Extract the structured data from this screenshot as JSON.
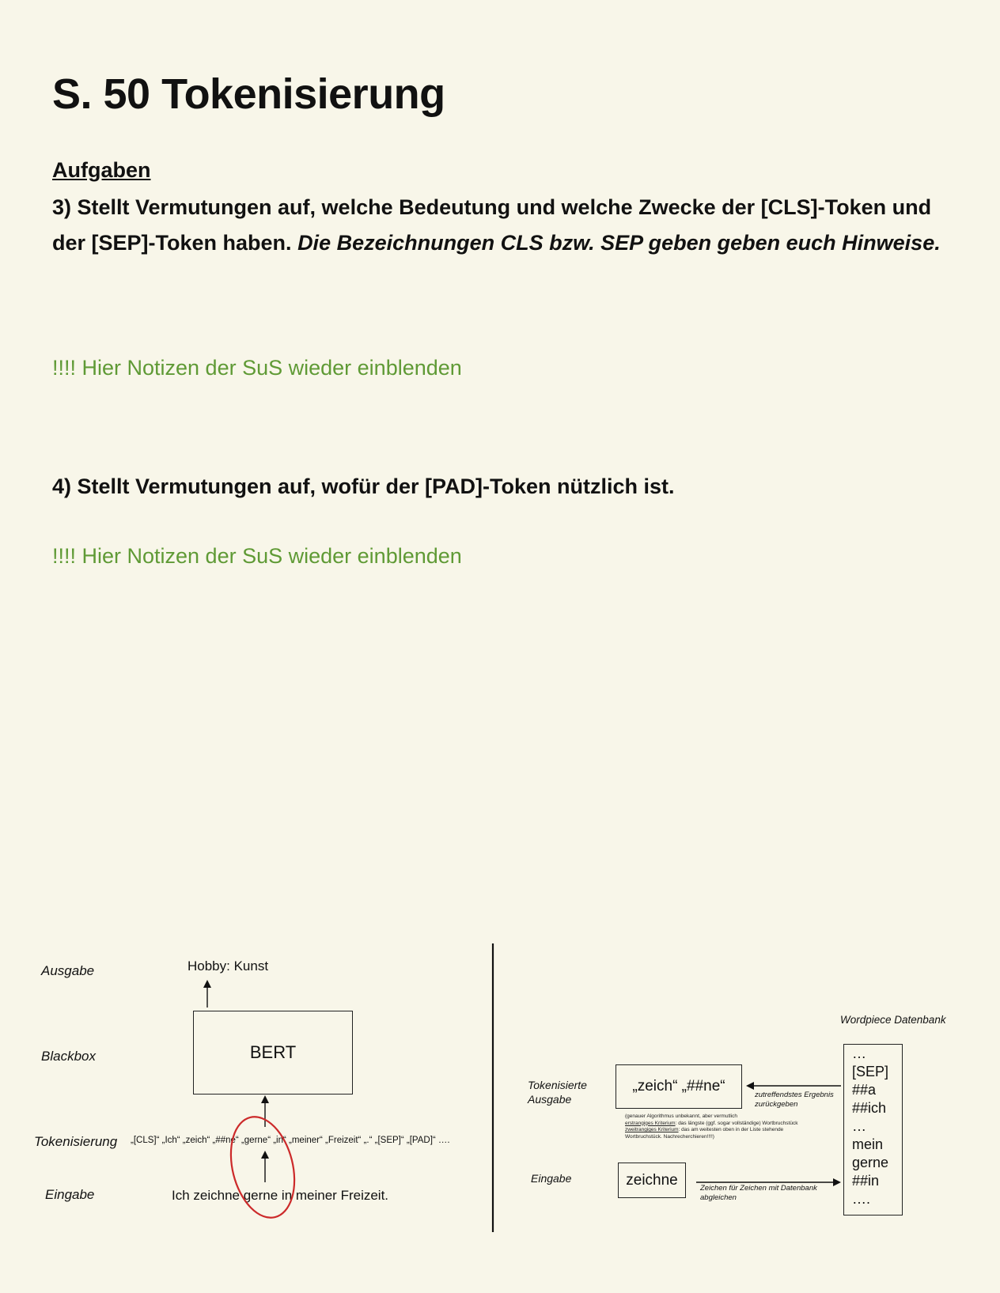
{
  "title": "S. 50 Tokenisierung",
  "section_heading": "Aufgaben",
  "task3": {
    "bold_text": "3) Stellt Vermutungen auf, welche Bedeutung und welche Zwecke der [CLS]-Token und der [SEP]-Token haben.",
    "italic_text": "Die Bezeichnungen CLS bzw. SEP geben geben euch Hinweise."
  },
  "note_1": "!!!! Hier Notizen der SuS wieder einblenden",
  "task4": "4) Stellt Vermutungen auf, wofür der [PAD]-Token nützlich ist.",
  "note_2": "!!!! Hier Notizen der SuS wieder einblenden",
  "left_diagram": {
    "row_labels": {
      "output": "Ausgabe",
      "blackbox": "Blackbox",
      "tokenization": "Tokenisierung",
      "input": "Eingabe"
    },
    "output_text": "Hobby: Kunst",
    "model_name": "BERT",
    "token_sequence": "„[CLS]“ „Ich“ „zeich“ „##ne“ „gerne“ „in“ „meiner“ „Freizeit“ „.“ „[SEP]“ „[PAD]“ ….",
    "input_sentence": "Ich zeichne gerne in meiner Freizeit."
  },
  "right_diagram": {
    "database_label": "Wordpiece Datenbank",
    "database_items": [
      "…",
      "[SEP]",
      "##a",
      "##ich",
      "…",
      "mein",
      "gerne",
      "##in",
      "…."
    ],
    "tokenized_output_label": "Tokenisierte Ausgabe",
    "tokenized_output_value": "„zeich“ „##ne“",
    "return_arrow_label": "zutreffendstes Ergebnis zurückgeben",
    "algorithm_note": {
      "line1": "(genauer Algorithmus unbekannt, aber vermutlich",
      "crit1_label": "erstrangiges Kriterium",
      "crit1_text": ": das längste (ggf. sogar vollständige) Wortbruchstück",
      "crit2_label": "zweitrangiges Kriterium",
      "crit2_text": ": das am weitesten oben in der Liste stehende",
      "line4": "Wortbruchstück. Nachrecherchieren!!!!)"
    },
    "input_label": "Eingabe",
    "input_value": "zeichne",
    "compare_arrow_label": "Zeichen für Zeichen mit Datenbank abgleichen"
  }
}
